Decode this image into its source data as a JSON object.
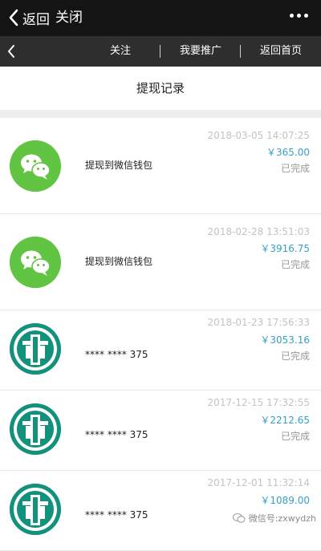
{
  "topbar": {
    "back_label": "返回",
    "close_label": "关闭"
  },
  "navbar": {
    "items": [
      "关注",
      "我要推广",
      "返回首页"
    ]
  },
  "page": {
    "title": "提现记录"
  },
  "records": [
    {
      "icon": "wechat-icon",
      "desc": "提现到微信钱包",
      "time": "2018-03-05 14:07:25",
      "amount": "￥365.00",
      "status": "已完成"
    },
    {
      "icon": "wechat-icon",
      "desc": "提现到微信钱包",
      "time": "2018-02-28 13:51:03",
      "amount": "￥3916.75",
      "status": "已完成"
    },
    {
      "icon": "abc-bank-icon",
      "desc": "**** ****  375",
      "time": "2018-01-23 17:56:33",
      "amount": "￥3053.16",
      "status": "已完成"
    },
    {
      "icon": "abc-bank-icon",
      "desc": "**** ****  375",
      "time": "2017-12-15 17:32:55",
      "amount": "￥2212.65",
      "status": "已完成"
    },
    {
      "icon": "abc-bank-icon",
      "desc": "**** ****  375",
      "time": "2017-12-01 11:32:14",
      "amount": "￥1089.00",
      "status": ""
    }
  ],
  "watermark": {
    "text": "微信号:zxwydzh"
  },
  "colors": {
    "wechat_green": "#62c443",
    "bank_teal": "#12917c",
    "amount_blue": "#35a0c9"
  }
}
